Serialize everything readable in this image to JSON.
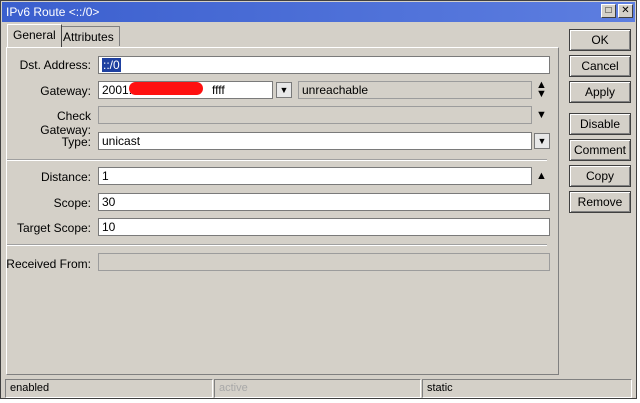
{
  "window": {
    "title": "IPv6 Route <::/0>"
  },
  "tabs": [
    {
      "label": "General"
    },
    {
      "label": "Attributes"
    }
  ],
  "form": {
    "dst_address": {
      "label": "Dst. Address:",
      "value": "::/0"
    },
    "gateway": {
      "label": "Gateway:",
      "value_prefix": "2001:",
      "value_suffix": "ffff",
      "state": "unreachable"
    },
    "check_gateway": {
      "label": "Check Gateway:",
      "value": ""
    },
    "type": {
      "label": "Type:",
      "value": "unicast"
    },
    "distance": {
      "label": "Distance:",
      "value": "1"
    },
    "scope": {
      "label": "Scope:",
      "value": "30"
    },
    "target_scope": {
      "label": "Target Scope:",
      "value": "10"
    },
    "received_from": {
      "label": "Received From:",
      "value": ""
    }
  },
  "buttons": [
    "OK",
    "Cancel",
    "Apply",
    "Disable",
    "Comment",
    "Copy",
    "Remove"
  ],
  "status": {
    "left": "enabled",
    "middle": "active",
    "right": "static"
  },
  "colors": {
    "titlebar": "#3b5fce",
    "selection": "#1e40a0",
    "redaction": "#ff1010"
  }
}
